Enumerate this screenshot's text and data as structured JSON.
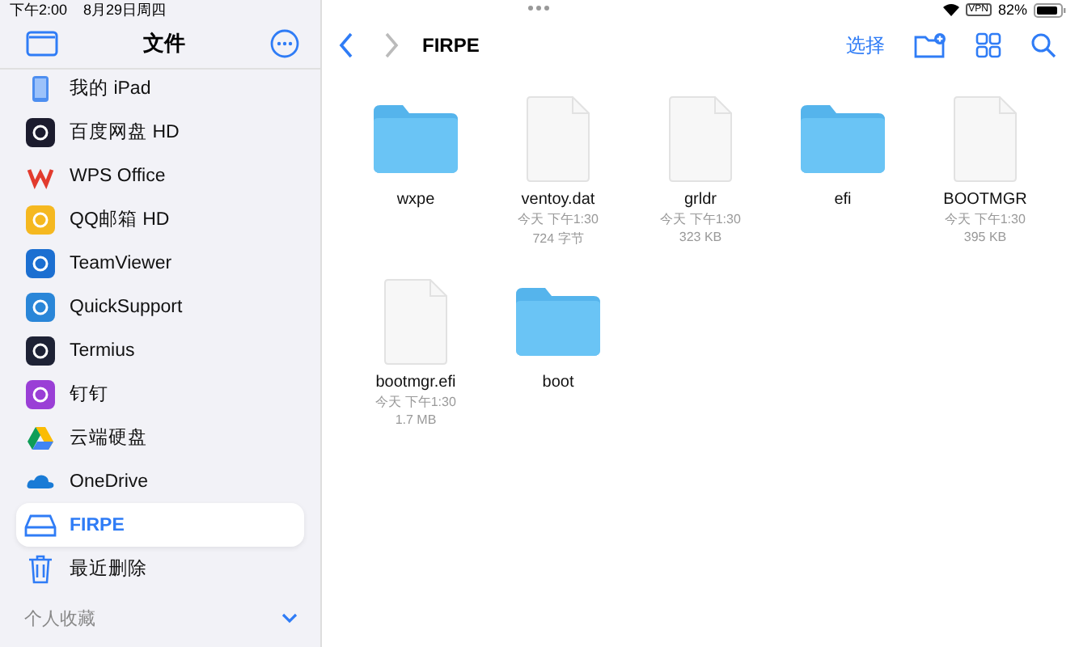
{
  "status_bar": {
    "time": "下午2:00",
    "date": "8月29日周四",
    "vpn": "VPN",
    "battery": "82%"
  },
  "sidebar": {
    "title": "文件",
    "items": [
      {
        "label": "我的 iPad",
        "kind": "ipad",
        "selected": false
      },
      {
        "label": "百度网盘 HD",
        "kind": "app",
        "color": "#1c1c2e",
        "selected": false
      },
      {
        "label": "WPS Office",
        "kind": "wps",
        "selected": false
      },
      {
        "label": "QQ邮箱 HD",
        "kind": "app",
        "color": "#f5b820",
        "selected": false
      },
      {
        "label": "TeamViewer",
        "kind": "app",
        "color": "#1c6fd1",
        "selected": false
      },
      {
        "label": "QuickSupport",
        "kind": "app",
        "color": "#2a86d8",
        "selected": false
      },
      {
        "label": "Termius",
        "kind": "app",
        "color": "#1e2235",
        "selected": false
      },
      {
        "label": "钉钉",
        "kind": "app",
        "color": "#9a3fd6",
        "selected": false
      },
      {
        "label": "云端硬盘",
        "kind": "gdrive",
        "selected": false
      },
      {
        "label": "OneDrive",
        "kind": "cloud",
        "selected": false
      },
      {
        "label": "FIRPE",
        "kind": "drive",
        "selected": true
      },
      {
        "label": "最近删除",
        "kind": "trash",
        "selected": false
      }
    ],
    "section": "个人收藏"
  },
  "toolbar": {
    "title": "FIRPE",
    "select": "选择"
  },
  "files": [
    {
      "kind": "folder",
      "name": "wxpe"
    },
    {
      "kind": "file",
      "name": "ventoy.dat",
      "date": "今天 下午1:30",
      "size": "724 字节"
    },
    {
      "kind": "file",
      "name": "grldr",
      "date": "今天 下午1:30",
      "size": "323 KB"
    },
    {
      "kind": "folder",
      "name": "efi"
    },
    {
      "kind": "file",
      "name": "BOOTMGR",
      "date": "今天 下午1:30",
      "size": "395 KB"
    },
    {
      "kind": "file",
      "name": "bootmgr.efi",
      "date": "今天 下午1:30",
      "size": "1.7 MB"
    },
    {
      "kind": "folder",
      "name": "boot"
    }
  ]
}
